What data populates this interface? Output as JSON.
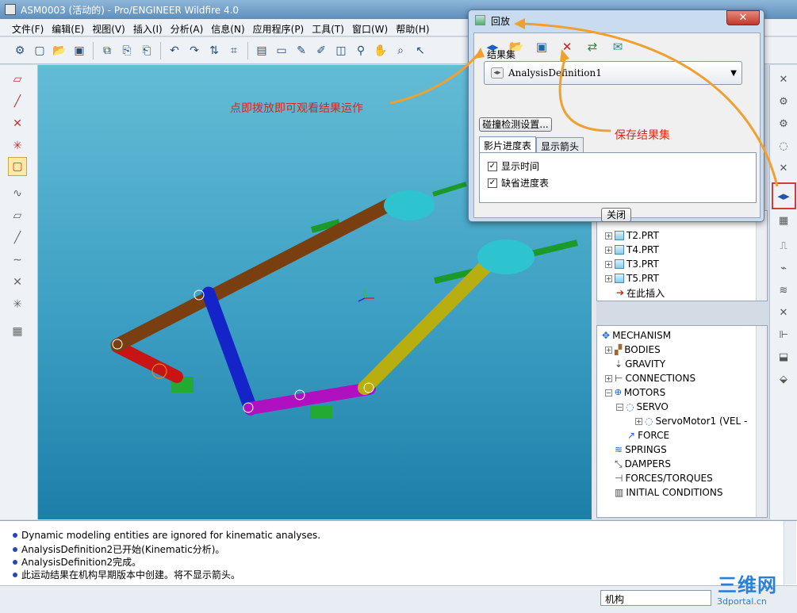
{
  "window": {
    "title": "ASM0003 (活动的) - Pro/ENGINEER Wildfire 4.0"
  },
  "menu": [
    "文件(F)",
    "编辑(E)",
    "视图(V)",
    "插入(I)",
    "分析(A)",
    "信息(N)",
    "应用程序(P)",
    "工具(T)",
    "窗口(W)",
    "帮助(H)"
  ],
  "model_tree": {
    "items": [
      {
        "label": "T2.PRT",
        "type": "part"
      },
      {
        "label": "T4.PRT",
        "type": "part"
      },
      {
        "label": "T3.PRT",
        "type": "part"
      },
      {
        "label": "T5.PRT",
        "type": "part"
      },
      {
        "label": "在此插入",
        "type": "insert"
      }
    ]
  },
  "mechanism_tree": {
    "items": [
      {
        "label": "MECHANISM",
        "depth": 0,
        "icon": "mechanism-icon"
      },
      {
        "label": "BODIES",
        "depth": 1,
        "icon": "bodies-icon"
      },
      {
        "label": "GRAVITY",
        "depth": 1,
        "icon": "gravity-icon"
      },
      {
        "label": "CONNECTIONS",
        "depth": 1,
        "icon": "connections-icon"
      },
      {
        "label": "MOTORS",
        "depth": 1,
        "icon": "motors-icon"
      },
      {
        "label": "SERVO",
        "depth": 2,
        "icon": "servo-icon"
      },
      {
        "label": "ServoMotor1 (VEL -",
        "depth": 3,
        "icon": "servo-motor-icon"
      },
      {
        "label": "FORCE",
        "depth": 2,
        "icon": "force-icon"
      },
      {
        "label": "SPRINGS",
        "depth": 1,
        "icon": "springs-icon"
      },
      {
        "label": "DAMPERS",
        "depth": 1,
        "icon": "dampers-icon"
      },
      {
        "label": "FORCES/TORQUES",
        "depth": 1,
        "icon": "forces-torques-icon"
      },
      {
        "label": "INITIAL CONDITIONS",
        "depth": 1,
        "icon": "initial-conditions-icon"
      }
    ]
  },
  "messages": [
    "Dynamic modeling entities are ignored for kinematic analyses.",
    "AnalysisDefinition2已开始(Kinematic分析)。",
    "AnalysisDefinition2完成。",
    "此运动结果在机构早期版本中创建。将不显示箭头。"
  ],
  "statusbar": {
    "filter": "机构"
  },
  "watermark": {
    "main": "三维网",
    "sub": "3dportal.cn"
  },
  "dialog": {
    "title": "回放",
    "result_set_label": "结果集",
    "result_set_value": "AnalysisDefinition1",
    "collision_button": "碰撞检测设置...",
    "tabs": [
      "影片进度表",
      "显示箭头"
    ],
    "checkboxes": [
      {
        "label": "显示时间",
        "checked": true
      },
      {
        "label": "缺省进度表",
        "checked": true
      }
    ],
    "close_button": "关闭"
  },
  "annotations": {
    "play_hint": "点即拨放即可观看结果运作",
    "save_hint": "保存结果集"
  },
  "colors": {
    "accent_red": "#d8261c",
    "arrow_orange": "#f0a030",
    "viewport_top": "#63bcd6",
    "viewport_bottom": "#1d7fa8"
  }
}
